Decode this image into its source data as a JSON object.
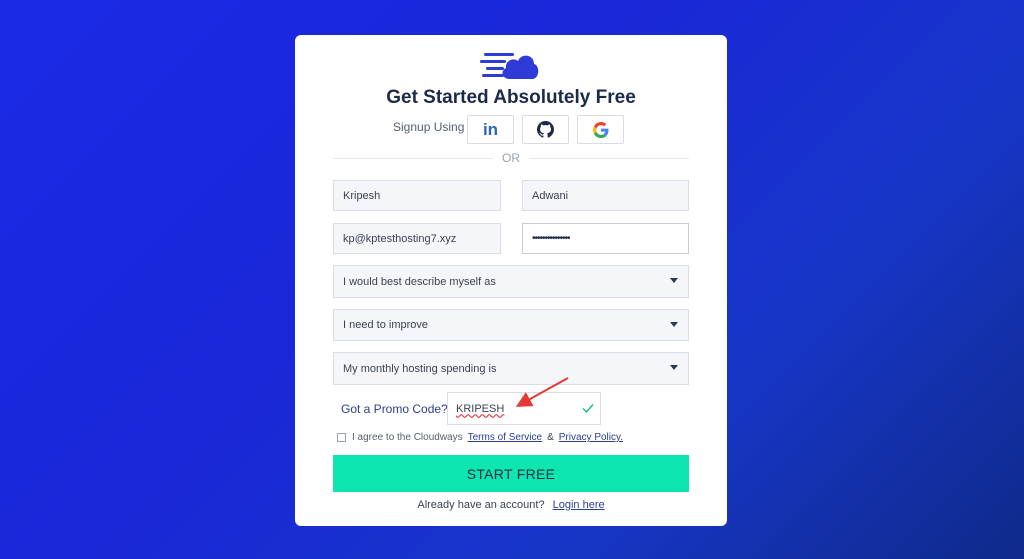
{
  "form": {
    "title": "Get Started Absolutely Free",
    "signup_using": "Signup Using",
    "social": [
      {
        "name": "LinkedIn",
        "icon": "linkedin-icon",
        "glyph": "in"
      },
      {
        "name": "GitHub",
        "icon": "github-icon"
      },
      {
        "name": "Google",
        "icon": "google-icon"
      }
    ],
    "or": "OR",
    "first_name": "Kripesh",
    "last_name": "Adwani",
    "email": "kp@kptesthosting7.xyz",
    "password": "•••••••••••••••",
    "describe_select": "I would best describe myself as",
    "improve_select": "I need to improve",
    "spending_select": "My monthly hosting spending is",
    "promo_label": "Got a Promo Code?",
    "promo_value": "KRIPESH",
    "agree_text": "I agree to the Cloudways",
    "terms_link": "Terms of Service",
    "ampersand": "&",
    "privacy_link": "Privacy Policy.",
    "submit": "START FREE",
    "already_text": "Already have an account?",
    "login_link": "Login here"
  },
  "colors": {
    "background": "#1b2ae6",
    "accent": "#0ee6b0",
    "title": "#1d2a4a",
    "link": "#2c3f8f",
    "logo": "#2f3bd6",
    "annotation_arrow": "#e53935"
  }
}
